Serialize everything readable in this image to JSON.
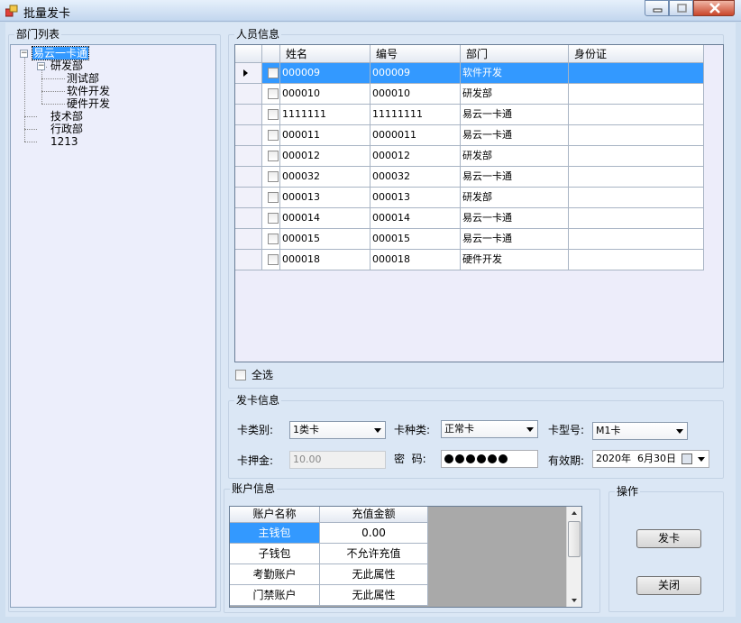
{
  "window": {
    "title": "批量发卡"
  },
  "dept_panel": {
    "title": "部门列表",
    "tree": [
      {
        "label": "易云一卡通",
        "selected": true
      },
      {
        "label": "研发部"
      },
      {
        "label": "测试部"
      },
      {
        "label": "软件开发"
      },
      {
        "label": "硬件开发"
      },
      {
        "label": "技术部"
      },
      {
        "label": "行政部"
      },
      {
        "label": "1213"
      }
    ]
  },
  "staff_panel": {
    "title": "人员信息",
    "columns": [
      "姓名",
      "编号",
      "部门",
      "身份证"
    ],
    "rows": [
      {
        "name": "000009",
        "id": "000009",
        "dept": "软件开发",
        "idcard": "",
        "selected": true
      },
      {
        "name": "000010",
        "id": "000010",
        "dept": "研发部",
        "idcard": ""
      },
      {
        "name": "1111111",
        "id": "11111111",
        "dept": "易云一卡通",
        "idcard": ""
      },
      {
        "name": "000011",
        "id": "0000011",
        "dept": "易云一卡通",
        "idcard": ""
      },
      {
        "name": "000012",
        "id": "000012",
        "dept": "研发部",
        "idcard": ""
      },
      {
        "name": "000032",
        "id": "000032",
        "dept": "易云一卡通",
        "idcard": ""
      },
      {
        "name": "000013",
        "id": "000013",
        "dept": "研发部",
        "idcard": ""
      },
      {
        "name": "000014",
        "id": "000014",
        "dept": "易云一卡通",
        "idcard": ""
      },
      {
        "name": "000015",
        "id": "000015",
        "dept": "易云一卡通",
        "idcard": ""
      },
      {
        "name": "000018",
        "id": "000018",
        "dept": "硬件开发",
        "idcard": ""
      }
    ],
    "select_all_label": "全选"
  },
  "card_panel": {
    "title": "发卡信息",
    "card_category_label": "卡类别:",
    "card_category_value": "1类卡",
    "card_kind_label": "卡种类:",
    "card_kind_value": "正常卡",
    "card_model_label": "卡型号:",
    "card_model_value": "M1卡",
    "deposit_label": "卡押金:",
    "deposit_value": "10.00",
    "password_label": "密  码:",
    "password_length": 6,
    "validity_label": "有效期:",
    "validity_value": "2020年  6月30日"
  },
  "account_panel": {
    "title": "账户信息",
    "columns": [
      "账户名称",
      "充值金额"
    ],
    "rows": [
      {
        "name": "主钱包",
        "amount": "0.00",
        "selected": true
      },
      {
        "name": "子钱包",
        "amount": "不允许充值"
      },
      {
        "name": "考勤账户",
        "amount": "无此属性"
      },
      {
        "name": "门禁账户",
        "amount": "无此属性"
      }
    ]
  },
  "ops_panel": {
    "title": "操作",
    "issue_label": "发卡",
    "close_label": "关闭"
  },
  "colors": {
    "selection": "#3399ff",
    "form_bg": "#dbe7f5",
    "grid_bg": "#ededfa"
  }
}
